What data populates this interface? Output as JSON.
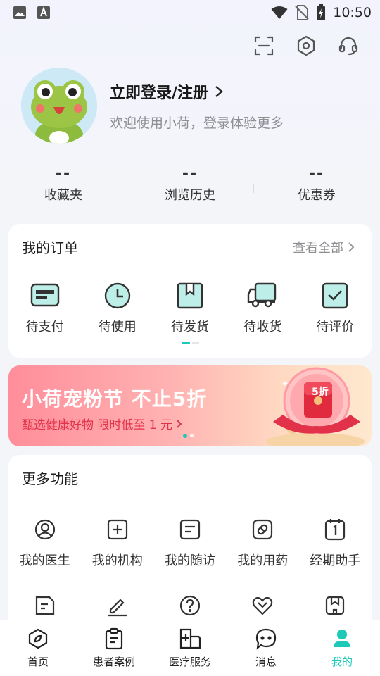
{
  "status_bar": {
    "time": "10:50"
  },
  "profile": {
    "login_label": "立即登录/注册",
    "welcome": "欢迎使用小荷，登录体验更多"
  },
  "stats": [
    {
      "value": "--",
      "label": "收藏夹"
    },
    {
      "value": "--",
      "label": "浏览历史"
    },
    {
      "value": "--",
      "label": "优惠券"
    }
  ],
  "orders": {
    "title": "我的订单",
    "view_all": "查看全部",
    "items": [
      {
        "label": "待支付",
        "icon": "card-icon"
      },
      {
        "label": "待使用",
        "icon": "clock-icon"
      },
      {
        "label": "待发货",
        "icon": "box-icon"
      },
      {
        "label": "待收货",
        "icon": "truck-icon"
      },
      {
        "label": "待评价",
        "icon": "check-icon"
      }
    ]
  },
  "banner": {
    "title": "小荷宠粉节 不止5折",
    "subtitle": "甄选健康好物 限时低至 1 元",
    "badge": "5折"
  },
  "more": {
    "title": "更多功能",
    "items": [
      {
        "label": "我的医生",
        "icon": "doctor-icon"
      },
      {
        "label": "我的机构",
        "icon": "hospital-icon"
      },
      {
        "label": "我的随访",
        "icon": "followup-icon"
      },
      {
        "label": "我的用药",
        "icon": "pill-icon"
      },
      {
        "label": "经期助手",
        "icon": "calendar-icon"
      }
    ],
    "row2_icons": [
      "document-icon",
      "sign-icon",
      "help-icon",
      "heart-icon",
      "shop-icon"
    ]
  },
  "tabbar": [
    {
      "label": "首页",
      "icon": "home-icon",
      "active": false
    },
    {
      "label": "患者案例",
      "icon": "clipboard-icon",
      "active": false
    },
    {
      "label": "医疗服务",
      "icon": "medical-icon",
      "active": false
    },
    {
      "label": "消息",
      "icon": "message-icon",
      "active": false
    },
    {
      "label": "我的",
      "icon": "user-icon",
      "active": true
    }
  ],
  "colors": {
    "accent": "#1ec9b8",
    "banner_red": "#e2324a"
  }
}
